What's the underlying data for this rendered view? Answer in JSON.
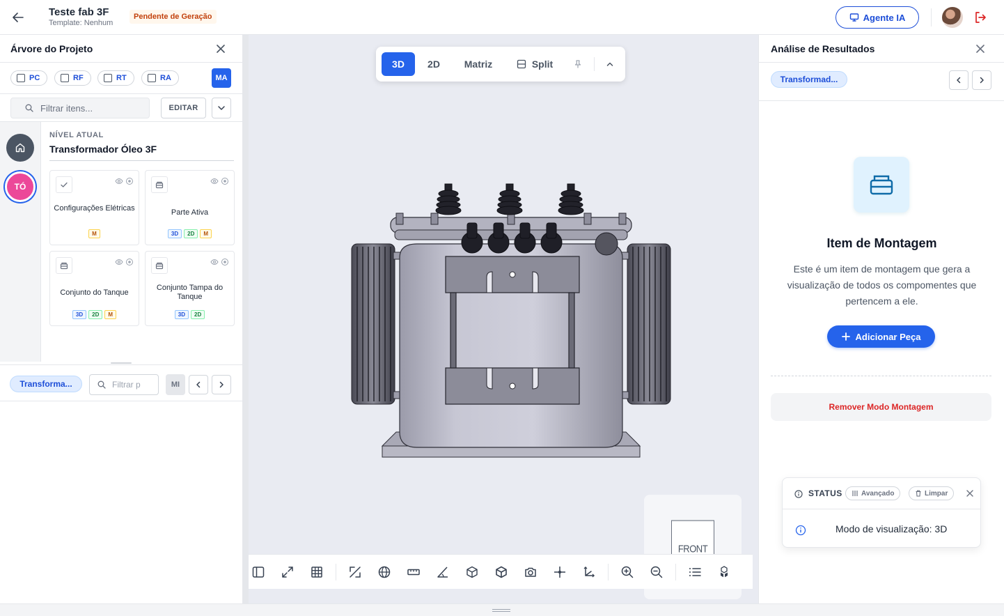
{
  "header": {
    "project_title": "Teste fab 3F",
    "template_label": "Template: Nenhum",
    "status_badge": "Pendente de Geração",
    "agent_button": "Agente IA"
  },
  "left_panel": {
    "title": "Árvore do Projeto",
    "filters": [
      "PC",
      "RF",
      "RT",
      "RA"
    ],
    "ma_button": "MA",
    "search_placeholder": "Filtrar itens...",
    "edit_button": "EDITAR",
    "rail_avatar": "TÓ",
    "level_label": "NÍVEL ATUAL",
    "level_name": "Transformador Óleo 3F",
    "cards": [
      {
        "name": "Configurações Elétricas",
        "icon": "check-icon",
        "tags": [
          "M"
        ]
      },
      {
        "name": "Parte Ativa",
        "icon": "package-icon",
        "tags": [
          "3D",
          "2D",
          "M"
        ]
      },
      {
        "name": "Conjunto do Tanque",
        "icon": "package-icon",
        "tags": [
          "3D",
          "2D",
          "M"
        ]
      },
      {
        "name": "Conjunto Tampa do Tanque",
        "icon": "package-icon",
        "tags": [
          "3D",
          "2D"
        ]
      }
    ],
    "sub_chip": "Transforma...",
    "sub_search_placeholder": "Filtrar p",
    "mi_button": "MI"
  },
  "viewer": {
    "tabs": [
      "3D",
      "2D",
      "Matriz",
      "Split"
    ],
    "active_tab": "3D",
    "viewcube_face": "FRONT",
    "toolbar_icons": [
      "sidebar-toggle-icon",
      "fullscreen-icon",
      "grid-icon",
      "section-icon",
      "globe-icon",
      "measure-icon",
      "angle-icon",
      "cube-outline-icon",
      "cube-solid-icon",
      "camera-icon",
      "center-icon",
      "axes-icon",
      "zoom-in-icon",
      "zoom-out-icon",
      "list-icon",
      "explode-icon"
    ]
  },
  "right_panel": {
    "title": "Análise de Resultados",
    "chip": "Transformad...",
    "item_title": "Item de Montagem",
    "item_description": "Este é um item de montagem que gera a visualização de todos os compomentes que pertencem a ele.",
    "add_button": "Adicionar Peça",
    "remove_button": "Remover Modo Montagem",
    "status": {
      "label": "STATUS",
      "advanced": "Avançado",
      "clear": "Limpar",
      "message": "Modo de visualização: 3D"
    }
  },
  "colors": {
    "primary": "#2563eb",
    "pending": "#c2410c",
    "danger": "#dc2626",
    "avatar_pink": "#ec4899"
  }
}
